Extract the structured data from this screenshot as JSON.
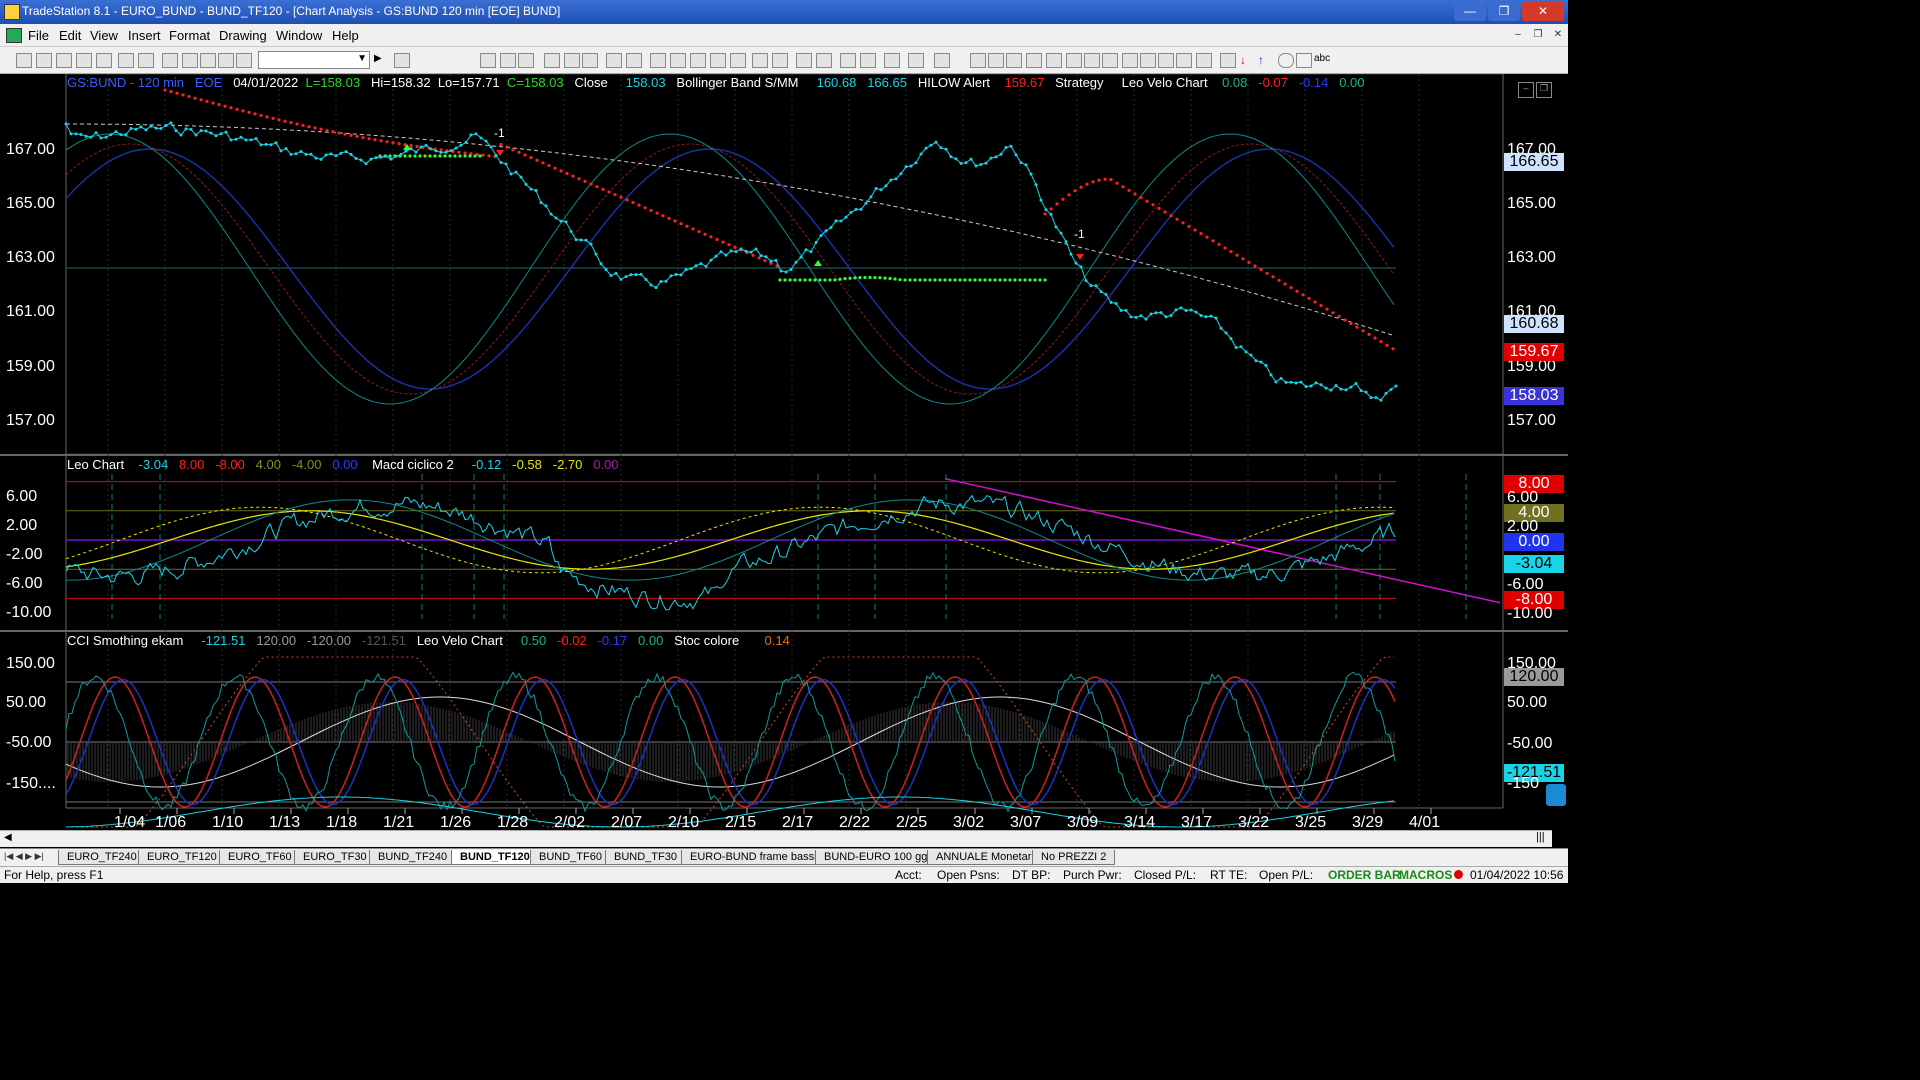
{
  "window": {
    "title": "TradeStation 8.1 - EURO_BUND - BUND_TF120 - [Chart Analysis - GS:BUND  120 min  [EOE] BUND]",
    "minimize": "—",
    "maximize": "❐",
    "close": "✕"
  },
  "menu": {
    "items": [
      "File",
      "Edit",
      "View",
      "Insert",
      "Format",
      "Drawing",
      "Window",
      "Help"
    ],
    "mdi": [
      "–",
      "❐",
      "✕"
    ]
  },
  "toolbar": {
    "combo_value": ""
  },
  "header_price": {
    "symbol": "GS:BUND - 120 min",
    "session": "EOE",
    "date": "04/01/2022",
    "low_close": "L=158.03",
    "hi": "Hi=158.32",
    "lo": "Lo=157.71",
    "c": "C=158.03",
    "close_label": "Close",
    "close_val": "158.03",
    "boll_label": "Bollinger Band S/MM",
    "boll_v1": "160.68",
    "boll_v2": "166.65",
    "hilow_label": "HILOW Alert",
    "hilow_val": "159.67",
    "strategy_label": "Strategy",
    "leovelo_label": "Leo Velo Chart",
    "lv1": "0.08",
    "lv2": "-0.07",
    "lv3": "-0.14",
    "lv4": "0.00"
  },
  "header_osc": {
    "leo_label": "Leo Chart",
    "v1": "-3.04",
    "v2": "8.00",
    "v3": "-8.00",
    "v4": "4.00",
    "v5": "-4.00",
    "v6": "0.00",
    "macd_label": "Macd ciclico 2",
    "m1": "-0.12",
    "m2": "-0.58",
    "m3": "-2.70",
    "m4": "0.00"
  },
  "header_cci": {
    "cci_label": "CCI Smothing ekam",
    "c1": "-121.51",
    "c2": "120.00",
    "c3": "-120.00",
    "c4": "-121.51",
    "lv_label": "Leo Velo Chart",
    "l1": "0.50",
    "l2": "-0.02",
    "l3": "-0.17",
    "l4": "0.00",
    "stoc_label": "Stoc colore",
    "stoc_val": "0.14"
  },
  "price_axis": [
    "167.00",
    "165.00",
    "163.00",
    "161.00",
    "159.00",
    "157.00"
  ],
  "osc_axis": [
    "6.00",
    "2.00",
    "-2.00",
    "-6.00",
    "-10.00"
  ],
  "cci_axis": [
    "150.00",
    "50.00",
    "-50.00",
    "-150...."
  ],
  "right_price": {
    "t1": "167.00",
    "t2": "165.00",
    "t3": "163.00",
    "t4": "161.00",
    "t5": "159.00",
    "t6": "157.00",
    "box_boll_top": "166.65",
    "box_boll_bot": "160.68",
    "box_hilow": "159.67",
    "box_close": "158.03"
  },
  "right_osc": {
    "box_8": "8.00",
    "t6": "6.00",
    "box_4": "4.00",
    "t2": "2.00",
    "box_0": "0.00",
    "box_m3": "-3.04",
    "tm6": "-6.00",
    "box_m8": "-8.00",
    "tm10": "-10.00"
  },
  "right_cci": {
    "t150": "150.00",
    "box_120": "120.00",
    "t50": "50.00",
    "tm50": "-50.00",
    "box_m121": "-121.51",
    "tm150": "-150"
  },
  "x_axis": [
    "1/04",
    "1/06",
    "1/10",
    "1/13",
    "1/18",
    "1/21",
    "1/26",
    "1/28",
    "2/02",
    "2/07",
    "2/10",
    "2/15",
    "2/17",
    "2/22",
    "2/25",
    "3/02",
    "3/07",
    "3/09",
    "3/14",
    "3/17",
    "3/22",
    "3/25",
    "3/29",
    "4/01"
  ],
  "trade_marker": "-1",
  "tabs": [
    "EURO_TF240",
    "EURO_TF120",
    "EURO_TF60",
    "EURO_TF30",
    "BUND_TF240",
    "BUND_TF120",
    "BUND_TF60",
    "BUND_TF30",
    "EURO-BUND frame bassi",
    "BUND-EURO 100 gg",
    "ANNUALE Monetari",
    "No PREZZI 2"
  ],
  "active_tab": "BUND_TF120",
  "status": {
    "help": "For Help, press F1",
    "acct": "Acct:",
    "open_psns": "Open Psns:",
    "dt_bp": "DT BP:",
    "purch_pwr": "Purch Pwr:",
    "closed_pl": "Closed P/L:",
    "rt_te": "RT TE:",
    "open_pl": "Open P/L:",
    "order_bar": "ORDER BAR",
    "macros": "MACROS",
    "datetime": "01/04/2022 10:56"
  },
  "colors": {
    "price": "#19d3e6",
    "boll_outer": "#0f8a8a",
    "boll_mid": "#8b1a1a",
    "boll_blue": "#1c2fa6",
    "hilow_red": "#ff2020",
    "hilow_green": "#33ff33",
    "white_avg": "#c8c8c8",
    "osc_yellow": "#e6e600",
    "macd_line": "#d010d0",
    "cci_red": "#d02020",
    "cci_blue": "#2030c0"
  }
}
